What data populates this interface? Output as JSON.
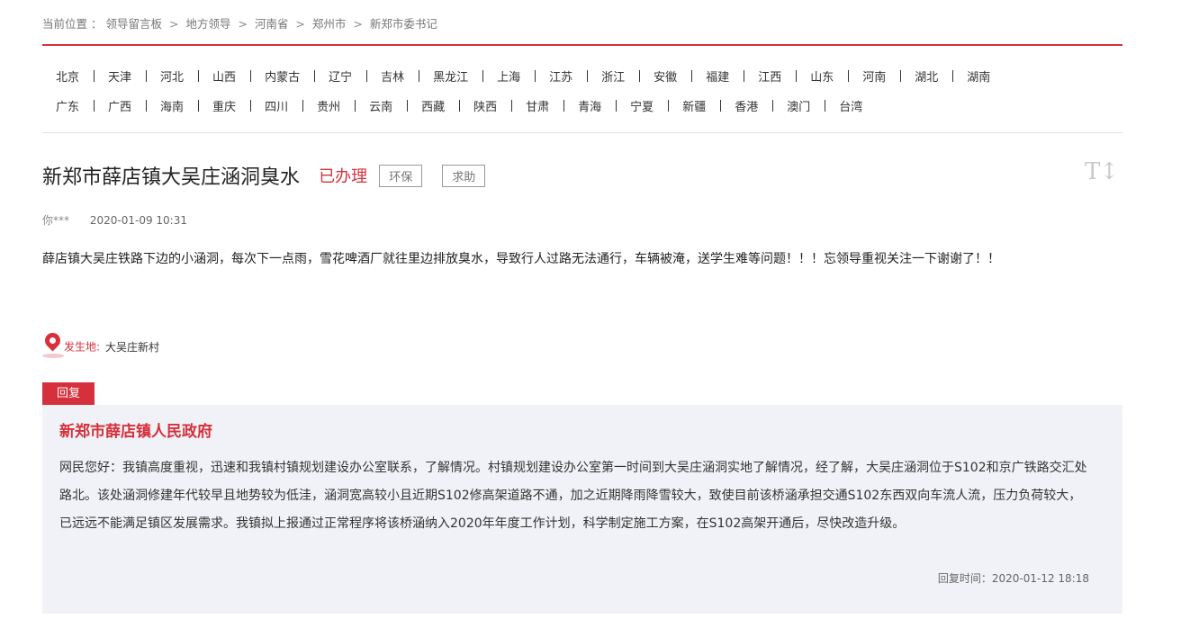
{
  "breadcrumb": {
    "prefix": "当前位置 ：",
    "items": [
      "领导留言板",
      "地方领导",
      "河南省",
      "郑州市",
      "新郑市委书记"
    ],
    "separator": ">"
  },
  "regions": {
    "row1": [
      "北京",
      "天津",
      "河北",
      "山西",
      "内蒙古",
      "辽宁",
      "吉林",
      "黑龙江",
      "上海",
      "江苏",
      "浙江",
      "安徽",
      "福建",
      "江西",
      "山东",
      "河南",
      "湖北",
      "湖南"
    ],
    "row2": [
      "广东",
      "广西",
      "海南",
      "重庆",
      "四川",
      "贵州",
      "云南",
      "西藏",
      "陕西",
      "甘肃",
      "青海",
      "宁夏",
      "新疆",
      "香港",
      "澳门",
      "台湾"
    ]
  },
  "message": {
    "title": "新郑市薛店镇大吴庄涵洞臭水",
    "status": "已办理",
    "tags": [
      "环保",
      "求助"
    ],
    "author": "你***",
    "date": "2020-01-09 10:31",
    "content": "薛店镇大吴庄铁路下边的小涵洞，每次下一点雨，雪花啤酒厂就往里边排放臭水，导致行人过路无法通行，车辆被淹，送学生难等问题！！！忘领导重视关注一下谢谢了！！",
    "location_label": "发生地:",
    "location_value": "大吴庄新村",
    "font_size_icon": "font-size-icon"
  },
  "reply": {
    "tab_label": "回复",
    "org": "新郑市薛店镇人民政府",
    "content": "网民您好：我镇高度重视，迅速和我镇村镇规划建设办公室联系，了解情况。村镇规划建设办公室第一时间到大吴庄涵洞实地了解情况，经了解，大吴庄涵洞位于S102和京广铁路交汇处路北。该处涵洞修建年代较早且地势较为低洼，涵洞宽高较小且近期S102修高架道路不通，加之近期降雨降雪较大，致使目前该桥涵承担交通S102东西双向车流人流，压力负荷较大，已远远不能满足镇区发展需求。我镇拟上报通过正常程序将该桥涵纳入2020年年度工作计划，科学制定施工方案，在S102高架开通后，尽快改造升级。",
    "time": "回复时间：2020-01-12 18:18"
  },
  "colors": {
    "accent": "#d5303b",
    "reply_bg": "#f1f2f7"
  }
}
